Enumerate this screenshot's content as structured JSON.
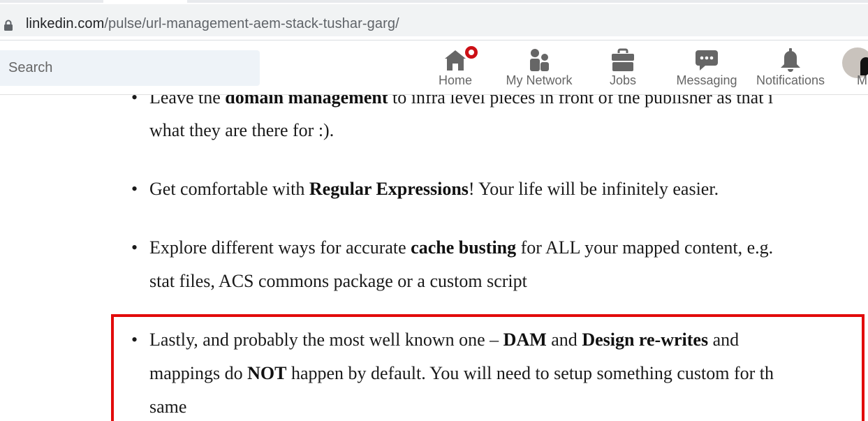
{
  "browser": {
    "url_host": "linkedin.com",
    "url_path": "/pulse/url-management-aem-stack-tushar-garg/"
  },
  "header": {
    "search_placeholder": "Search",
    "nav": [
      {
        "label": "Home",
        "icon": "home-icon",
        "has_badge": true
      },
      {
        "label": "My Network",
        "icon": "network-icon"
      },
      {
        "label": "Jobs",
        "icon": "briefcase-icon"
      },
      {
        "label": "Messaging",
        "icon": "messaging-icon"
      },
      {
        "label": "Notifications",
        "icon": "bell-icon"
      },
      {
        "label": "M",
        "icon": "avatar"
      }
    ],
    "colors": {
      "icon": "#666666",
      "badge": "#cc1016"
    }
  },
  "article": {
    "items": [
      {
        "lines": [
          [
            {
              "t": "Leave the "
            },
            {
              "t": "domain management",
              "b": true
            },
            {
              "t": " to infra level pieces in front of the publisher as that i"
            }
          ],
          [
            {
              "t": "what they are there for :)."
            }
          ]
        ]
      },
      {
        "lines": [
          [
            {
              "t": "Get comfortable with "
            },
            {
              "t": "Regular Expressions",
              "b": true
            },
            {
              "t": "! Your life will be infinitely easier."
            }
          ]
        ]
      },
      {
        "lines": [
          [
            {
              "t": "Explore different ways for accurate "
            },
            {
              "t": "cache busting",
              "b": true
            },
            {
              "t": " for ALL your mapped content, e.g."
            }
          ],
          [
            {
              "t": "stat files, ACS commons package or a custom script"
            }
          ]
        ]
      },
      {
        "lines": [
          [
            {
              "t": "Lastly, and probably the most well known one – "
            },
            {
              "t": "DAM",
              "b": true
            },
            {
              "t": " and "
            },
            {
              "t": "Design re-writes",
              "b": true
            },
            {
              "t": " and"
            }
          ],
          [
            {
              "t": "mappings do "
            },
            {
              "t": "NOT",
              "b": true
            },
            {
              "t": " happen by default. You will need to setup something custom for th"
            }
          ],
          [
            {
              "t": "same"
            }
          ]
        ]
      }
    ],
    "highlight_color": "#e20b0b"
  }
}
